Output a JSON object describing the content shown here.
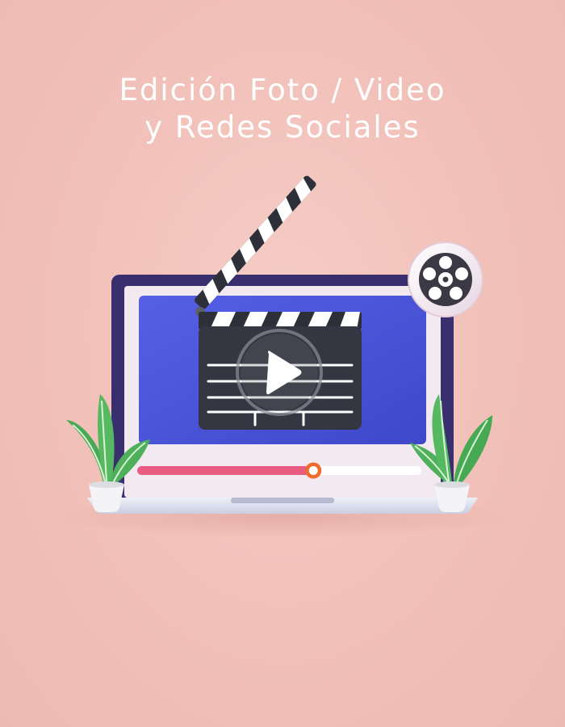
{
  "hero": {
    "title_line1": "Edición Foto / Video",
    "title_line2": "y Redes Sociales"
  },
  "player": {
    "progress": 0.62,
    "icon": "play-icon"
  },
  "icons": {
    "clapperboard": "clapperboard-icon",
    "film_reel": "film-reel-icon",
    "plants": "plant-icon"
  },
  "colors": {
    "background": "#f2c3bc",
    "screen_blue": "#4a55d8",
    "laptop_frame": "#3a2f6e",
    "progress_fill": "#ea5d83",
    "progress_knob": "#f06a2b",
    "clapper": "#33363f",
    "plant_green": "#4fb35a"
  }
}
